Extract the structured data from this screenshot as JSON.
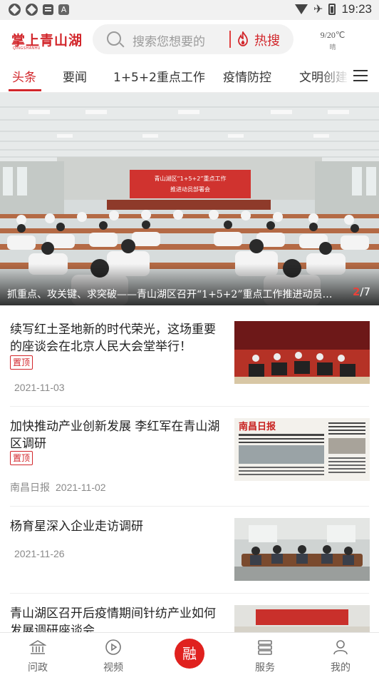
{
  "status_bar": {
    "time": "19:23",
    "left_icons": [
      "app-icon",
      "app-icon",
      "message-icon",
      "a-icon"
    ],
    "right_icons": [
      "wifi-icon",
      "airplane-icon",
      "battery-icon"
    ]
  },
  "header": {
    "logo_text": "掌上青山湖",
    "logo_sub": "QINGSHANHU",
    "search_placeholder": "搜索您想要的",
    "hot_label": "热搜",
    "weather_temp": "9/20℃",
    "weather_cond": "晴",
    "accent_color": "#d2262b"
  },
  "tabs": [
    {
      "label": "头条",
      "active": true
    },
    {
      "label": "要闻",
      "active": false
    },
    {
      "label": "1+5+2重点工作",
      "active": false
    },
    {
      "label": "疫情防控",
      "active": false
    },
    {
      "label": "文明创建",
      "active": false
    }
  ],
  "banner": {
    "caption": "抓重点、攻关键、求突破——青山湖区召开“1+5+2”重点工作推进动员部署会",
    "current": "2",
    "separator": "/",
    "total": "7",
    "screen_title": "青山湖区“1+5+2”重点工作",
    "screen_subtitle": "推进动员部署会"
  },
  "news": [
    {
      "title": "续写红土圣地新的时代荣光，这场重要的座谈会在北京人民大会堂举行！",
      "tag": "置顶",
      "source": "",
      "date": "2021-11-03"
    },
    {
      "title": "加快推动产业创新发展 李红军在青山湖区调研",
      "tag": "置顶",
      "source": "南昌日报",
      "date": "2021-11-02",
      "thumb_masthead": "南昌日报"
    },
    {
      "title": "杨育星深入企业走访调研",
      "tag": "",
      "source": "",
      "date": "2021-11-26"
    },
    {
      "title": "青山湖区召开后疫情期间针纺产业如何发展调研座谈会",
      "tag": "",
      "source": "",
      "date": ""
    }
  ],
  "bottom_nav": [
    {
      "label": "问政",
      "icon": "building-icon"
    },
    {
      "label": "视频",
      "icon": "play-icon"
    },
    {
      "label": "融",
      "icon": "rong-icon"
    },
    {
      "label": "服务",
      "icon": "service-icon"
    },
    {
      "label": "我的",
      "icon": "user-icon"
    }
  ]
}
